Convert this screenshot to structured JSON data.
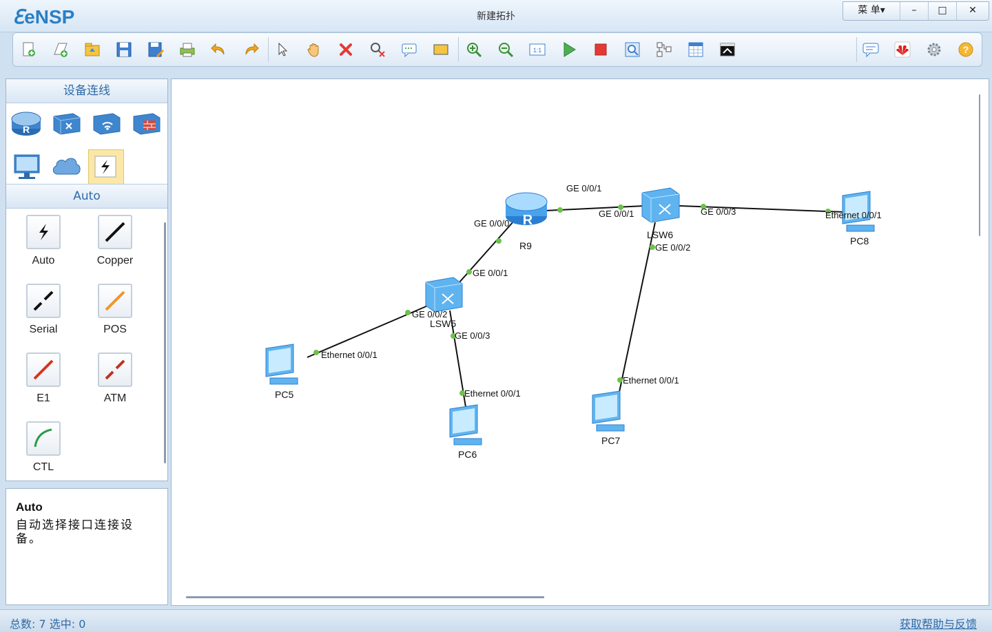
{
  "app": {
    "logo": "eNSP",
    "window_title": "新建拓扑",
    "menu_label": "菜 单▾",
    "minimize": "–",
    "maximize": "□",
    "close": "✕"
  },
  "toolbar": {
    "buttons": [
      "new-topology",
      "new-lab",
      "open",
      "save",
      "save-as",
      "print",
      "undo",
      "redo",
      "select",
      "pan",
      "delete",
      "delete-link",
      "text",
      "rectangle",
      "zoom-in",
      "zoom-out",
      "fit",
      "start-all",
      "stop-all",
      "capture",
      "topology",
      "grid",
      "console",
      "chat",
      "huawei",
      "settings",
      "help"
    ]
  },
  "left_panel": {
    "devices_header": "设备连线",
    "category_header": "Auto",
    "links": [
      {
        "label": "Auto",
        "color": "#111111"
      },
      {
        "label": "Copper",
        "color": "#111111"
      },
      {
        "label": "Serial",
        "color": "#111111"
      },
      {
        "label": "POS",
        "color": "#f0952a"
      },
      {
        "label": "E1",
        "color": "#d9321f"
      },
      {
        "label": "ATM",
        "color": "#c0311d"
      },
      {
        "label": "CTL",
        "color": "#2a9a4a"
      }
    ]
  },
  "description": {
    "title": "Auto",
    "text": "自动选择接口连接设备。"
  },
  "topology": {
    "devices": [
      {
        "id": "R9",
        "name": "R9",
        "type": "router"
      },
      {
        "id": "LSW5",
        "name": "LSW5",
        "type": "switch"
      },
      {
        "id": "LSW6",
        "name": "LSW6",
        "type": "switch"
      },
      {
        "id": "PC5",
        "name": "PC5",
        "type": "pc"
      },
      {
        "id": "PC6",
        "name": "PC6",
        "type": "pc"
      },
      {
        "id": "PC7",
        "name": "PC7",
        "type": "pc"
      },
      {
        "id": "PC8",
        "name": "PC8",
        "type": "pc"
      }
    ],
    "port_labels": {
      "r9_ge001": "GE 0/0/1",
      "r9_ge000": "GE 0/0/0",
      "lsw6_ge001": "GE 0/0/1",
      "lsw6_ge003": "GE 0/0/3",
      "lsw6_ge002": "GE 0/0/2",
      "pc8_eth": "Ethernet 0/0/1",
      "lsw5_ge001": "GE 0/0/1",
      "lsw5_ge002": "GE 0/0/2",
      "lsw5_ge003": "GE 0/0/3",
      "pc5_eth": "Ethernet 0/0/1",
      "pc6_eth": "Ethernet 0/0/1",
      "pc7_eth": "Ethernet 0/0/1"
    },
    "link_dot_color": "#6cc24a"
  },
  "status": {
    "summary": "总数: 7 选中: 0",
    "help_link": "获取帮助与反馈"
  }
}
